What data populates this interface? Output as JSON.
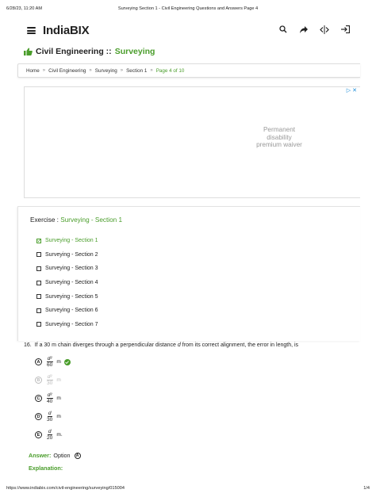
{
  "print_header": {
    "date": "6/28/23, 11:20 AM",
    "title": "Surveying Section 1 - Civil Engineering Questions and Answers Page 4"
  },
  "topbar": {
    "brand": "IndiaBIX",
    "icons": [
      "search-icon",
      "share-icon",
      "toggle-icon",
      "login-icon"
    ]
  },
  "section_title": {
    "prefix": "Civil Engineering :: ",
    "subject": "Surveying"
  },
  "breadcrumb": {
    "items": [
      "Home",
      "Civil Engineering",
      "Surveying",
      "Section 1"
    ],
    "current": "Page 4 of 10",
    "separator": "»"
  },
  "ad": {
    "text": "Permanent disability premium waiver",
    "badge": "▷ ✕"
  },
  "exercise": {
    "label": "Exercise : ",
    "value": "Surveying - Section 1",
    "sections": [
      "Surveying - Section 1",
      "Surveying - Section 2",
      "Surveying - Section 3",
      "Surveying - Section 4",
      "Surveying - Section 5",
      "Surveying - Section 6",
      "Surveying - Section 7"
    ],
    "active_index": 0
  },
  "question": {
    "number": "16.",
    "text_before": "If a 30 m chain diverges through a perpendicular distance ",
    "variable": "d",
    "text_after": " from its correct alignment, the error in length, is",
    "options": [
      {
        "letter": "A",
        "num": "d²",
        "den": "60",
        "unit": "m",
        "correct": true,
        "dim": false
      },
      {
        "letter": "B",
        "num": "d²",
        "den": "30",
        "unit": "m",
        "correct": false,
        "dim": true
      },
      {
        "letter": "C",
        "num": "d²",
        "den": "40",
        "unit": "m",
        "correct": false,
        "dim": false
      },
      {
        "letter": "D",
        "num": "d",
        "den": "30",
        "unit": "m",
        "correct": false,
        "dim": false
      },
      {
        "letter": "E",
        "num": "d",
        "den": "20",
        "unit": "m.",
        "correct": false,
        "dim": false
      }
    ]
  },
  "answer": {
    "label": "Answer:",
    "text": "Option",
    "letter": "A"
  },
  "explanation": {
    "label": "Explanation:"
  },
  "print_footer": {
    "url": "https://www.indiabix.com/civil-engineering/surveying/015004",
    "page": "1/4"
  },
  "colors": {
    "accent_green": "#4a9d2b",
    "ad_blue": "#1a8cd8"
  }
}
